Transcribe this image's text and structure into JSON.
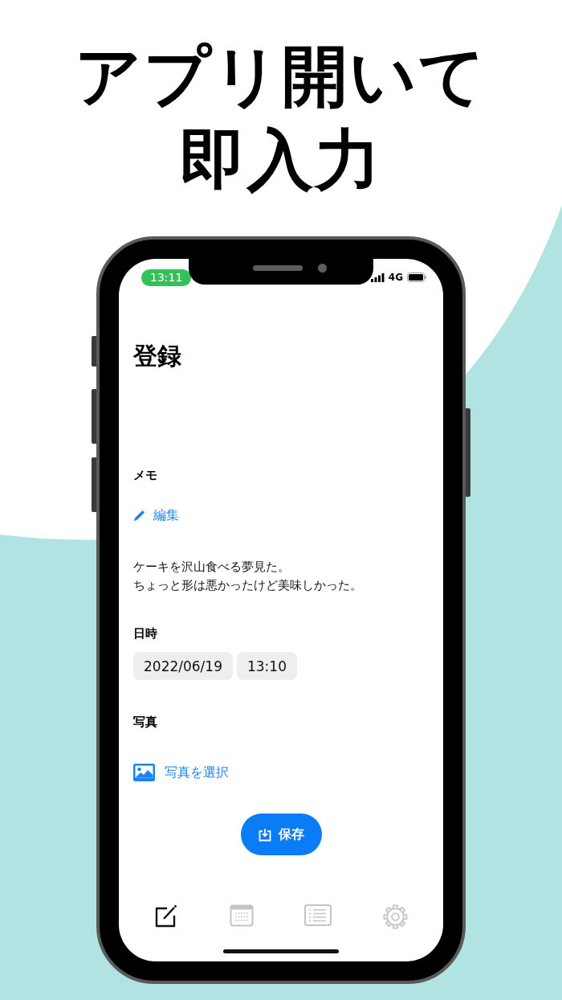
{
  "headline": [
    "アプリ開いて",
    "即入力"
  ],
  "status_bar": {
    "time": "13:11",
    "network": "4G"
  },
  "title": "登録",
  "memo": {
    "label": "メモ",
    "edit_link": "編集",
    "text_lines": [
      "ケーキを沢山食べる夢見た。",
      "ちょっと形は悪かったけど美味しかった。"
    ]
  },
  "datetime": {
    "label": "日時",
    "date": "2022/06/19",
    "time": "13:10"
  },
  "photo": {
    "label": "写真",
    "select_link": "写真を選択"
  },
  "save_button": "保存",
  "tab_bar": [
    {
      "kind": "compose",
      "selected": true
    },
    {
      "kind": "calendar",
      "selected": false
    },
    {
      "kind": "list",
      "selected": false
    },
    {
      "kind": "settings",
      "selected": false
    }
  ]
}
